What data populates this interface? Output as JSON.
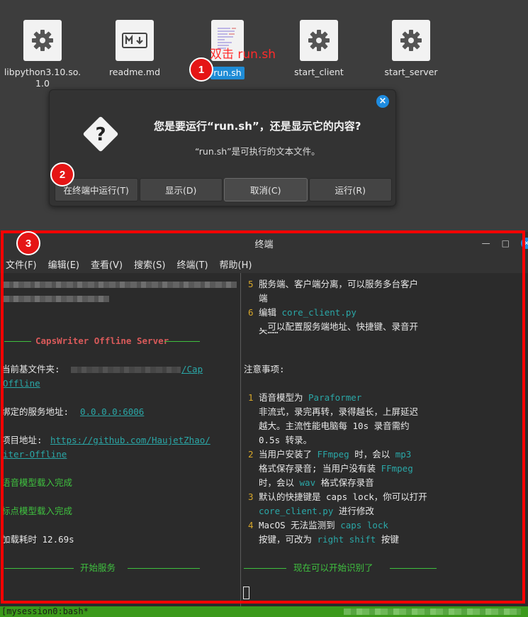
{
  "desktop": {
    "icons": [
      {
        "label": "libpython3.10.so.\n1.0",
        "type": "gear"
      },
      {
        "label": "readme.md",
        "type": "markdown"
      },
      {
        "label": "run.sh",
        "type": "script"
      },
      {
        "label": "start_client",
        "type": "gear"
      },
      {
        "label": "start_server",
        "type": "gear"
      }
    ],
    "annotation": "双击 run.sh",
    "badges": [
      "1",
      "2",
      "3"
    ]
  },
  "dialog": {
    "title": "您是要运行“run.sh”，还是显示它的内容?",
    "subtitle": "“run.sh”是可执行的文本文件。",
    "close_icon": "close-icon",
    "buttons": [
      "在终端中运行(T)",
      "显示(D)",
      "取消(C)",
      "运行(R)"
    ]
  },
  "terminal": {
    "title": "终端",
    "menu": [
      "文件(F)",
      "编辑(E)",
      "查看(V)",
      "搜索(S)",
      "终端(T)",
      "帮助(H)"
    ],
    "left": {
      "header": "CapsWriter Offline Server",
      "basedir_label": "当前基文件夹: ",
      "basedir_value": "/Cap",
      "basedir_value2": "Offline",
      "bind_label": "绑定的服务地址: ",
      "bind_value": "0.0.0.0:6006",
      "project_label": "项目地址: ",
      "project_value": "https://github.com/HaujetZhao/",
      "project_value2": "iter-Offline",
      "model_loaded": "语音模型载入完成",
      "punc_loaded": "标点模型载入完成",
      "load_time": "加载耗时 12.69s",
      "start_service": "开始服务"
    },
    "right": {
      "item5_num": "5",
      "item5_line1": "服务端、客户端分离，可以服务多台客户",
      "item5_line2": "端",
      "item6_num": "6",
      "item6_pre": "编辑 ",
      "item6_file": "core_client.py",
      "item6_line2": "，可以配置服务端地址、快捷键、录音开",
      "item6_line3": "关……",
      "notes_title": "注意事项:",
      "n1_num": "1",
      "n1_pre": "语音模型为 ",
      "n1_model": "Paraformer",
      "n1_l2": "非流式，录完再转，录得越长，上屏延迟",
      "n1_l3": "越大。主流性能电脑每 10s 录音需约",
      "n1_l4": "0.5s 转录。",
      "n2_num": "2",
      "n2_a": "当用户安装了 ",
      "n2_ffmpeg": "FFmpeg",
      "n2_b": " 时，会以 ",
      "n2_mp3": "mp3",
      "n2_l2a": "格式保存录音; 当用户没有装 ",
      "n2_l2b": "FFmpeg",
      "n2_l3a": "时，会以 ",
      "n2_wav": "wav",
      "n2_l3b": " 格式保存录音",
      "n3_num": "3",
      "n3_l1": "默认的快捷键是 caps lock，你可以打开",
      "n3_file": "core_client.py",
      "n3_l2": " 进行修改",
      "n4_num": "4",
      "n4_a": "MacOS 无法监测到 ",
      "n4_caps": "caps lock",
      "n4_l2a": "按键，可改为 ",
      "n4_shift": "right shift",
      "n4_l2b": " 按键",
      "ready": "现在可以开始识别了"
    },
    "status": "[mysession0:bash*"
  },
  "colors": {
    "accent_blue": "#1e8ce0",
    "annotation_red": "#ff0000",
    "terminal_green": "#3fc03f",
    "terminal_teal": "#2aa7a7",
    "terminal_red": "#d95a5a",
    "status_bar": "#3b9a1b"
  }
}
